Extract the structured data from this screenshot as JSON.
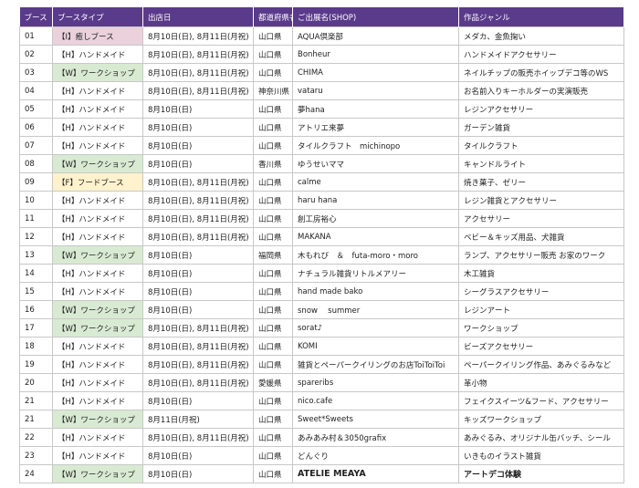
{
  "headers": [
    "ブース",
    "ブースタイプ",
    "出店日",
    "都道府県名",
    "ご出展名(SHOP)",
    "作品ジャンル"
  ],
  "rows": [
    {
      "booth": "01",
      "type": "【I】癒しブース",
      "type_code": "I",
      "date": "8月10日(日), 8月11日(月祝)",
      "pref": "山口県",
      "shop": "AQUA倶楽部",
      "genre": "メダカ、金魚掬い"
    },
    {
      "booth": "02",
      "type": "【H】ハンドメイド",
      "type_code": "H",
      "date": "8月10日(日), 8月11日(月祝)",
      "pref": "山口県",
      "shop": "Bonheur",
      "genre": "ハンドメイドアクセサリー"
    },
    {
      "booth": "03",
      "type": "【W】ワークショップ",
      "type_code": "W",
      "date": "8月10日(日), 8月11日(月祝)",
      "pref": "山口県",
      "shop": "CHIMA",
      "genre": "ネイルチップの販売ホイップデコ等のWS"
    },
    {
      "booth": "04",
      "type": "【H】ハンドメイド",
      "type_code": "H",
      "date": "8月10日(日), 8月11日(月祝)",
      "pref": "神奈川県",
      "shop": "vataru",
      "genre": "お名前入りキーホルダーの実演販売"
    },
    {
      "booth": "05",
      "type": "【H】ハンドメイド",
      "type_code": "H",
      "date": "8月10日(日)",
      "pref": "山口県",
      "shop": "夢hana",
      "genre": "レジンアクセサリー"
    },
    {
      "booth": "06",
      "type": "【H】ハンドメイド",
      "type_code": "H",
      "date": "8月10日(日)",
      "pref": "山口県",
      "shop": "アトリエ来夢",
      "genre": "ガーデン雑貨"
    },
    {
      "booth": "07",
      "type": "【H】ハンドメイド",
      "type_code": "H",
      "date": "8月10日(日)",
      "pref": "山口県",
      "shop": "タイルクラフト　michinopo",
      "genre": "タイルクラフト"
    },
    {
      "booth": "08",
      "type": "【W】ワークショップ",
      "type_code": "W",
      "date": "8月10日(日)",
      "pref": "香川県",
      "shop": "ゆうせいママ",
      "genre": "キャンドルライト"
    },
    {
      "booth": "09",
      "type": "【F】フードブース",
      "type_code": "F",
      "date": "8月10日(日), 8月11日(月祝)",
      "pref": "山口県",
      "shop": "calme",
      "genre": "焼き菓子、ゼリー"
    },
    {
      "booth": "10",
      "type": "【H】ハンドメイド",
      "type_code": "H",
      "date": "8月10日(日), 8月11日(月祝)",
      "pref": "山口県",
      "shop": "haru hana",
      "genre": "レジン雑貨とアクセサリー"
    },
    {
      "booth": "11",
      "type": "【H】ハンドメイド",
      "type_code": "H",
      "date": "8月10日(日), 8月11日(月祝)",
      "pref": "山口県",
      "shop": "創工房裕心",
      "genre": "アクセサリー"
    },
    {
      "booth": "12",
      "type": "【H】ハンドメイド",
      "type_code": "H",
      "date": "8月10日(日), 8月11日(月祝)",
      "pref": "山口県",
      "shop": "MAKANA",
      "genre": "ベビー＆キッズ用品、犬雑貨"
    },
    {
      "booth": "13",
      "type": "【W】ワークショップ",
      "type_code": "W",
      "date": "8月10日(日)",
      "pref": "福岡県",
      "shop": "木もれび　＆　futa-moro・moro",
      "genre": "ランプ、アクセサリー販売  お家のワーク"
    },
    {
      "booth": "14",
      "type": "【H】ハンドメイド",
      "type_code": "H",
      "date": "8月10日(日)",
      "pref": "山口県",
      "shop": "ナチュラル雑貨リトルメアリー",
      "genre": "木工雑貨"
    },
    {
      "booth": "15",
      "type": "【H】ハンドメイド",
      "type_code": "H",
      "date": "8月10日(日)",
      "pref": "山口県",
      "shop": "hand made bako",
      "genre": "シーグラスアクセサリー"
    },
    {
      "booth": "16",
      "type": "【W】ワークショップ",
      "type_code": "W",
      "date": "8月10日(日)",
      "pref": "山口県",
      "shop": "snow　 summer",
      "genre": "レジンアート"
    },
    {
      "booth": "17",
      "type": "【W】ワークショップ",
      "type_code": "W",
      "date": "8月10日(日), 8月11日(月祝)",
      "pref": "山口県",
      "shop": "sorat♪",
      "genre": "ワークショップ"
    },
    {
      "booth": "18",
      "type": "【H】ハンドメイド",
      "type_code": "H",
      "date": "8月10日(日), 8月11日(月祝)",
      "pref": "山口県",
      "shop": "KOMI",
      "genre": "ビーズアクセサリー"
    },
    {
      "booth": "19",
      "type": "【H】ハンドメイド",
      "type_code": "H",
      "date": "8月10日(日), 8月11日(月祝)",
      "pref": "山口県",
      "shop": "雑貨とペーパークイリングのお店ToiToiToi",
      "genre": "ペーパークイリング作品、あみぐるみなど"
    },
    {
      "booth": "20",
      "type": "【H】ハンドメイド",
      "type_code": "H",
      "date": "8月10日(日), 8月11日(月祝)",
      "pref": "愛媛県",
      "shop": "spareribs",
      "genre": "革小物"
    },
    {
      "booth": "21",
      "type": "【H】ハンドメイド",
      "type_code": "H",
      "date": "8月10日(日)",
      "pref": "山口県",
      "shop": "nico.cafe",
      "genre": "フェイクスイーツ&フード、アクセサリー"
    },
    {
      "booth": "21",
      "type": "【W】ワークショップ",
      "type_code": "W",
      "date": "8月11日(月祝)",
      "pref": "山口県",
      "shop": "Sweet*Sweets",
      "genre": "キッズワークショップ"
    },
    {
      "booth": "22",
      "type": "【H】ハンドメイド",
      "type_code": "H",
      "date": "8月10日(日), 8月11日(月祝)",
      "pref": "山口県",
      "shop": "あみあみ村＆3050grafix",
      "genre": "あみぐるみ、オリジナル缶バッチ、シール"
    },
    {
      "booth": "23",
      "type": "【H】ハンドメイド",
      "type_code": "H",
      "date": "8月10日(日)",
      "pref": "山口県",
      "shop": "どんぐり",
      "genre": "いきものイラスト雑貨"
    },
    {
      "booth": "24",
      "type": "【W】ワークショップ",
      "type_code": "W",
      "date": "8月10日(日)",
      "pref": "山口県",
      "shop": "ATELIE MEAYA",
      "genre": "アートデコ体験"
    }
  ]
}
